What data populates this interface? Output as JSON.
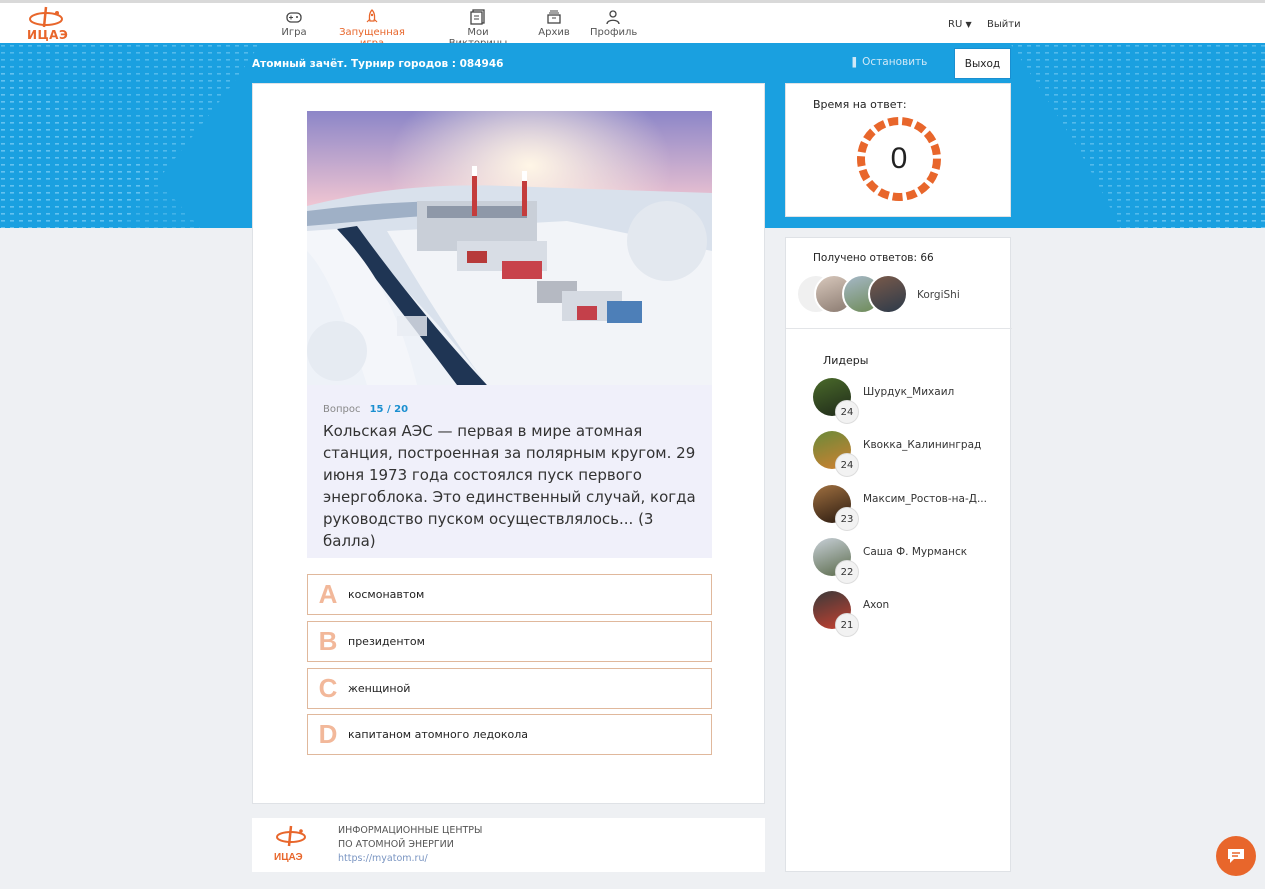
{
  "brand": {
    "logo_text": "ИЦАЭ",
    "accent": "#e8662b",
    "blue": "#1aa0e0"
  },
  "nav": {
    "items": [
      {
        "label": "Игра",
        "icon": "gamepad-icon"
      },
      {
        "label": "Запущенная игра",
        "icon": "rocket-icon"
      },
      {
        "label": "Мои Викторины",
        "icon": "quizzes-icon"
      },
      {
        "label": "Архив",
        "icon": "archive-icon"
      },
      {
        "label": "Профиль",
        "icon": "user-icon"
      }
    ],
    "active_index": 1,
    "lang": "RU",
    "logout": "Выйти"
  },
  "game": {
    "title": "Атомный зачёт. Турнир городов : 084946",
    "pause_label": "Остановить",
    "exit_label": "Выход"
  },
  "question": {
    "label": "Вопрос",
    "number": "15 / 20",
    "text": "Кольская АЭС — первая в мире атомная станция, построенная за полярным кругом. 29 июня 1973 года состоялся пуск первого энергоблока. Это единственный случай, когда руководство пуском осуществлялось... (3 балла)",
    "answers": [
      {
        "letter": "A",
        "text": "космонавтом"
      },
      {
        "letter": "B",
        "text": "президентом"
      },
      {
        "letter": "C",
        "text": "женщиной"
      },
      {
        "letter": "D",
        "text": "капитаном атомного ледокола"
      }
    ]
  },
  "timer": {
    "label": "Время на ответ:",
    "value": "0"
  },
  "answers_received": {
    "label": "Получено ответов: 66",
    "last_user": "KorgiShi"
  },
  "leaders": {
    "title": "Лидеры",
    "items": [
      {
        "name": "Шурдук_Михаил",
        "score": "24"
      },
      {
        "name": "Квокка_Калининград",
        "score": "24"
      },
      {
        "name": "Максим_Ростов-на-Д...",
        "score": "23"
      },
      {
        "name": "Саша Ф. Мурманск",
        "score": "22"
      },
      {
        "name": "Axon",
        "score": "21"
      }
    ]
  },
  "footer": {
    "line1": "ИНФОРМАЦИОННЫЕ ЦЕНТРЫ",
    "line2": "ПО АТОМНОЙ ЭНЕРГИИ",
    "url": "https://myatom.ru/",
    "logo_text": "ИЦАЭ"
  }
}
